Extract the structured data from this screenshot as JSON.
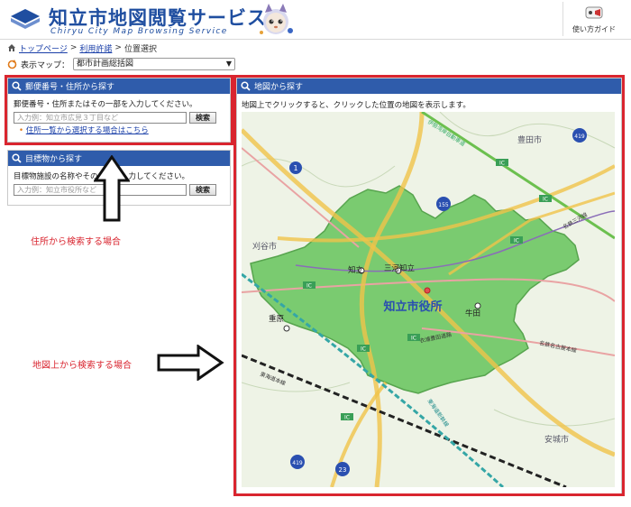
{
  "header": {
    "title": "知立市地図閲覧サービス",
    "subtitle": "Chiryu City Map Browsing Service",
    "guide_label": "使い方ガイド"
  },
  "breadcrumb": {
    "items": [
      "トップページ",
      "利用許諾",
      "位置選択"
    ],
    "separator": ">"
  },
  "display_map": {
    "label": "表示マップ：",
    "selected": "都市計画総括図"
  },
  "address_panel": {
    "title": "郵便番号・住所から探す",
    "instruction": "郵便番号・住所またはその一部を入力してください。",
    "placeholder": "入力例：知立市広見３丁目など",
    "button": "検索",
    "link_bullet": "•",
    "link": "住所一覧から選択する場合はこちら"
  },
  "landmark_panel": {
    "title": "目標物から探す",
    "instruction": "目標物施設の名称やその一部を入力してください。",
    "placeholder": "入力例：知立市役所など",
    "button": "検索"
  },
  "map_panel": {
    "title": "地図から探す",
    "instruction": "地図上でクリックすると、クリックした位置の地図を表示します。"
  },
  "annotations": {
    "address_search": "住所から検索する場合",
    "map_search": "地図上から検索する場合"
  },
  "map": {
    "city_hall": "知立市役所",
    "place_labels": [
      "知立",
      "三河知立",
      "牛田",
      "重原",
      "豊田市",
      "刈谷市",
      "安城市"
    ],
    "rail_labels": [
      "伊勢湾岸自動車道",
      "名鉄三河線",
      "名鉄名古屋本線",
      "東海道本線",
      "東海道新幹線",
      "衣浦豊田道路"
    ],
    "route_numbers": [
      "1",
      "155",
      "419",
      "419",
      "23"
    ],
    "ic_label": "IC"
  },
  "colors": {
    "header_blue": "#1f4ea0",
    "panel_header": "#2f5cab",
    "highlight_red": "#d9252f",
    "city_green": "#6fcf6a"
  }
}
